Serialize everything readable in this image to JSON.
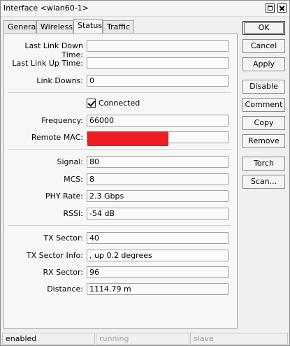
{
  "window": {
    "title": "Interface <wlan60-1>"
  },
  "tabs": [
    {
      "label": "General"
    },
    {
      "label": "Wireless"
    },
    {
      "label": "Status"
    },
    {
      "label": "Traffic"
    }
  ],
  "fields": {
    "last_link_down_time": {
      "label": "Last Link Down Time:",
      "value": ""
    },
    "last_link_up_time": {
      "label": "Last Link Up Time:",
      "value": ""
    },
    "link_downs": {
      "label": "Link Downs:",
      "value": "0"
    },
    "connected": {
      "label": "Connected",
      "checked": true
    },
    "frequency": {
      "label": "Frequency:",
      "value": "66000"
    },
    "remote_mac": {
      "label": "Remote MAC:",
      "value": "",
      "redaction_color": "#ee1c23"
    },
    "signal": {
      "label": "Signal:",
      "value": "80"
    },
    "mcs": {
      "label": "MCS:",
      "value": "8"
    },
    "phy_rate": {
      "label": "PHY Rate:",
      "value": "2.3 Gbps"
    },
    "rssi": {
      "label": "RSSI:",
      "value": "-54 dB"
    },
    "tx_sector": {
      "label": "TX Sector:",
      "value": "40"
    },
    "tx_sector_info": {
      "label": "TX Sector Info:",
      "value": ", up 0.2 degrees"
    },
    "rx_sector": {
      "label": "RX Sector:",
      "value": "96"
    },
    "distance": {
      "label": "Distance:",
      "value": "1114.79 m"
    }
  },
  "buttons": {
    "ok": "OK",
    "cancel": "Cancel",
    "apply": "Apply",
    "disable": "Disable",
    "comment": "Comment",
    "copy": "Copy",
    "remove": "Remove",
    "torch": "Torch",
    "scan": "Scan..."
  },
  "statusbar": {
    "state": "enabled",
    "running": "running",
    "slave": "slave"
  }
}
